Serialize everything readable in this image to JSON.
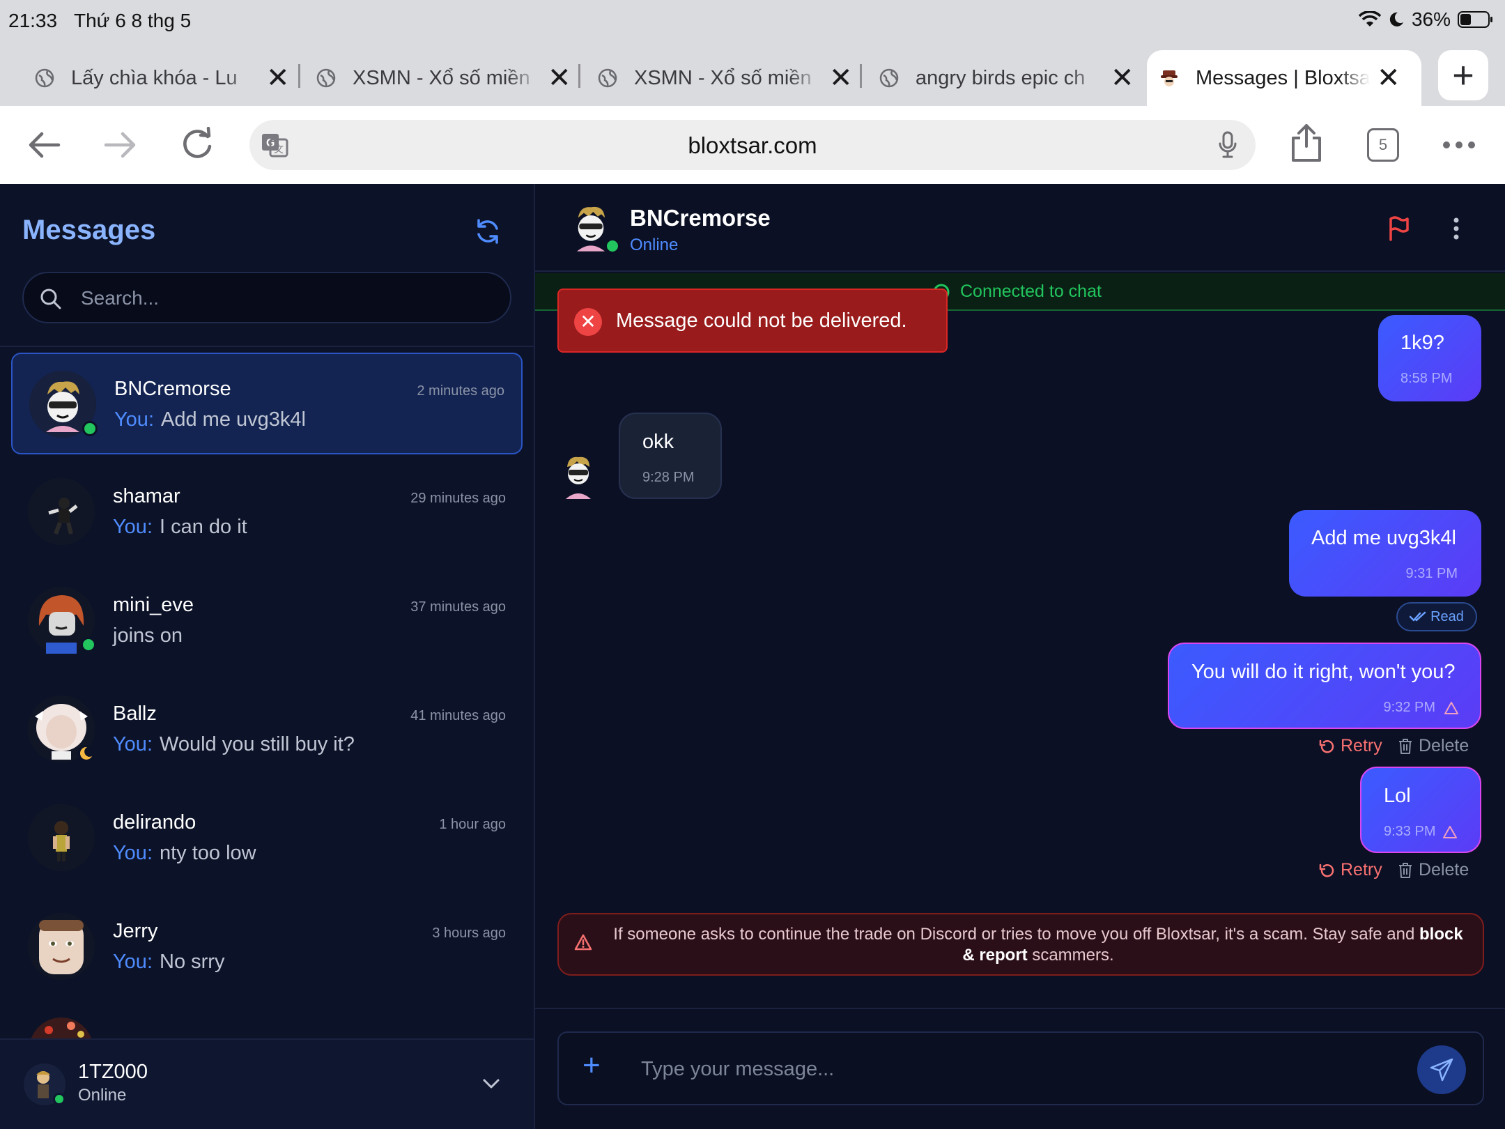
{
  "status_bar": {
    "time": "21:33",
    "date": "Thứ 6 8 thg 5",
    "battery": "36%"
  },
  "tabs": [
    {
      "title": "Lấy chìa khóa - Lu"
    },
    {
      "title": "XSMN - Xổ số miền"
    },
    {
      "title": "XSMN - Xổ số miền"
    },
    {
      "title": "angry birds epic ch"
    },
    {
      "title": "Messages | Bloxtsar"
    }
  ],
  "address_bar": {
    "url": "bloxtsar.com",
    "tab_count": "5"
  },
  "sidebar": {
    "title": "Messages",
    "search_placeholder": "Search...",
    "you_label": "You:",
    "conversations": [
      {
        "name": "BNCremorse",
        "time": "2 minutes ago",
        "preview": "Add me uvg3k4l",
        "from_you": true,
        "online": true
      },
      {
        "name": "shamar",
        "time": "29 minutes ago",
        "preview": "I can do it",
        "from_you": true,
        "online": false
      },
      {
        "name": "mini_eve",
        "time": "37 minutes ago",
        "preview": "joins on",
        "from_you": false,
        "online": true
      },
      {
        "name": "Ballz",
        "time": "41 minutes ago",
        "preview": "Would you still buy it?",
        "from_you": true,
        "online": false
      },
      {
        "name": "delirando",
        "time": "1 hour ago",
        "preview": "nty too low",
        "from_you": true,
        "online": false
      },
      {
        "name": "Jerry",
        "time": "3 hours ago",
        "preview": "No srry",
        "from_you": true,
        "online": false
      }
    ],
    "footer": {
      "username": "1TZ000",
      "status": "Online"
    }
  },
  "chat": {
    "contact_name": "BNCremorse",
    "contact_status": "Online",
    "connected_text": "Connected to chat",
    "error_toast": "Message could not be delivered.",
    "messages": [
      {
        "text": "1k9?",
        "time": "8:58 PM",
        "direction": "out"
      },
      {
        "text": "okk",
        "time": "9:28 PM",
        "direction": "in"
      },
      {
        "text": "Add me uvg3k4l",
        "time": "9:31 PM",
        "direction": "out",
        "receipt": "Read"
      },
      {
        "text": "You will do it right, won't you?",
        "time": "9:32 PM",
        "direction": "out",
        "failed": true
      },
      {
        "text": "Lol",
        "time": "9:33 PM",
        "direction": "out",
        "failed": true
      }
    ],
    "retry_label": "Retry",
    "delete_label": "Delete",
    "warning_part1": "If someone asks to continue the trade on Discord or tries to move you off Bloxtsar, it's a scam. Stay safe and",
    "warning_bold": "block & report",
    "warning_part2": "scammers.",
    "composer_placeholder": "Type your message..."
  },
  "colors": {
    "accent": "#4f8cff",
    "online": "#22c55e",
    "error": "#ef4444",
    "bubble_out": "#3b5bff",
    "background": "#0b1024"
  }
}
